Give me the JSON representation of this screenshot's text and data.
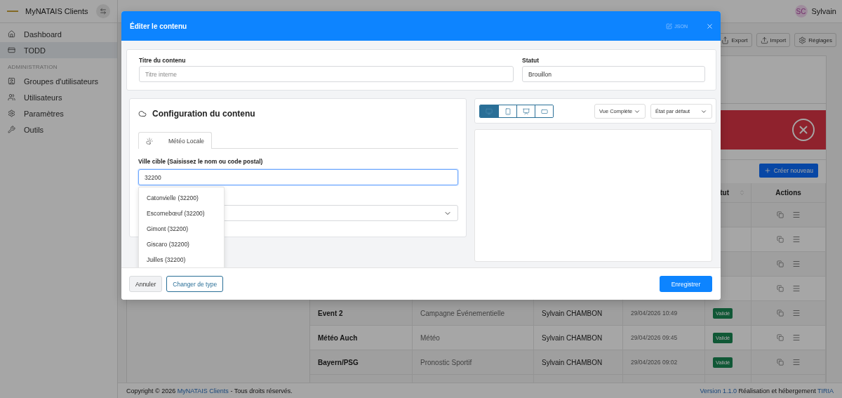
{
  "sidebar": {
    "brand": "MyNATAIS Clients",
    "items": [
      {
        "label": "Dashboard",
        "kind": "home",
        "selected": false
      },
      {
        "label": "TODD",
        "kind": "card",
        "selected": true
      }
    ],
    "section": "ADMINISTRATION",
    "admin_items": [
      {
        "label": "Groupes d'utilisateurs",
        "kind": "group",
        "selected": false
      },
      {
        "label": "Utilisateurs",
        "kind": "users",
        "selected": false
      },
      {
        "label": "Paramètres",
        "kind": "settings",
        "selected": false
      },
      {
        "label": "Outils",
        "kind": "tools",
        "selected": false
      }
    ]
  },
  "topbar": {
    "avatar": "SC",
    "user": "Sylvain"
  },
  "toolbar": [
    {
      "label": "Export",
      "kind": "export"
    },
    {
      "label": "Import",
      "kind": "import"
    },
    {
      "label": "Réglages",
      "kind": "settings"
    }
  ],
  "create_button": "Créer nouveau",
  "table": {
    "status_header": "tut",
    "actions_header": "Actions",
    "rows": [
      {
        "name": "Event 2",
        "type": "Campagne Événementielle",
        "author": "Sylvain CHAMBON",
        "date": "29/04/2026 10:49",
        "status": "Validé"
      },
      {
        "name": "Météo Auch",
        "type": "Météo",
        "author": "Sylvain CHAMBON",
        "date": "29/04/2026 09:45",
        "status": "Validé"
      },
      {
        "name": "Bayern/PSG",
        "type": "Pronostic Sportif",
        "author": "Sylvain CHAMBON",
        "date": "29/04/2026 09:02",
        "status": "Validé"
      }
    ]
  },
  "footer": {
    "copyright_before": "Copyright © 2026",
    "copyright_link": "MyNATAIS Clients",
    "copyright_after": "- Tous droits réservés.",
    "version": "Version 1.1.0",
    "credit": "Réalisation et hébergement",
    "credit_link": "TIRIA"
  },
  "modal": {
    "title": "Éditer le contenu",
    "json_button": "JSON",
    "title_field": {
      "label": "Titre du contenu",
      "placeholder": "Titre interne"
    },
    "status_field": {
      "label": "Statut",
      "value": "Brouillon"
    },
    "config": {
      "title": "Configuration du contenu",
      "tabs": [
        {
          "label": "Météo Locale",
          "selected": true
        }
      ],
      "city_field": {
        "label": "Ville cible (Saisissez le nom ou code postal)",
        "value": "32200"
      },
      "suggestions": [
        "Catonvielle (32200)",
        "Escornebœuf (32200)",
        "Gimont (32200)",
        "Giscaro (32200)",
        "Juilles (32200)"
      ]
    },
    "preview": {
      "devices": [
        {
          "kind": "desktop",
          "selected": true
        },
        {
          "kind": "mobile",
          "selected": false
        },
        {
          "kind": "presentation",
          "selected": false
        },
        {
          "kind": "tablet",
          "selected": false
        }
      ],
      "view_select": "Vue Complète",
      "state_select": "État par défaut"
    },
    "buttons": {
      "cancel": "Annuler",
      "change_type": "Changer de type",
      "save": "Enregistrer"
    }
  }
}
